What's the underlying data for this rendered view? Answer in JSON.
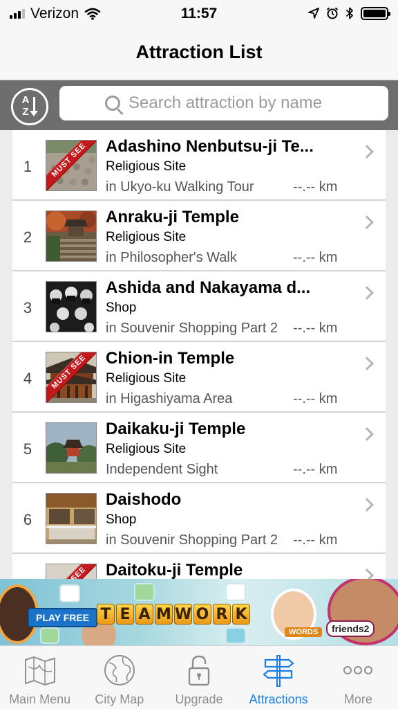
{
  "status_bar": {
    "carrier": "Verizon",
    "time": "11:57"
  },
  "nav": {
    "title": "Attraction List"
  },
  "search": {
    "placeholder": "Search attraction by name",
    "sort_label_a": "A",
    "sort_label_z": "Z"
  },
  "attractions": [
    {
      "number": "1",
      "name": "Adashino Nenbutsu-ji Te...",
      "category": "Religious Site",
      "location": "in Ukyo-ku Walking Tour",
      "distance": "--.-- km",
      "badge": "MUST SEE"
    },
    {
      "number": "2",
      "name": "Anraku-ji Temple",
      "category": "Religious Site",
      "location": "in Philosopher's Walk",
      "distance": "--.-- km",
      "badge": ""
    },
    {
      "number": "3",
      "name": "Ashida and Nakayama d...",
      "category": "Shop",
      "location": "in Souvenir Shopping Part 2",
      "distance": "--.-- km",
      "badge": ""
    },
    {
      "number": "4",
      "name": "Chion-in Temple",
      "category": "Religious Site",
      "location": "in Higashiyama Area",
      "distance": "--.-- km",
      "badge": "MUST SEE"
    },
    {
      "number": "5",
      "name": "Daikaku-ji Temple",
      "category": "Religious Site",
      "location": "Independent Sight",
      "distance": "--.-- km",
      "badge": ""
    },
    {
      "number": "6",
      "name": "Daishodo",
      "category": "Shop",
      "location": "in Souvenir Shopping Part 2",
      "distance": "--.-- km",
      "badge": ""
    },
    {
      "number": "",
      "name": "Daitoku-ji Temple",
      "category": "",
      "location": "",
      "distance": "",
      "badge": "MUST SEE"
    }
  ],
  "ad": {
    "play_free": "PLAY FREE",
    "teamwork_letters": [
      "T",
      "E",
      "A",
      "M",
      "W",
      "O",
      "R",
      "K"
    ],
    "words_tag": "WORDS",
    "friends_tag": "friends2"
  },
  "tabs": [
    {
      "label": "Main Menu",
      "icon": "map-icon",
      "active": false
    },
    {
      "label": "City Map",
      "icon": "globe-icon",
      "active": false
    },
    {
      "label": "Upgrade",
      "icon": "lock-icon",
      "active": false
    },
    {
      "label": "Attractions",
      "icon": "signpost-icon",
      "active": true
    },
    {
      "label": "More",
      "icon": "more-icon",
      "active": false
    }
  ],
  "colors": {
    "active_tab": "#1a7fe6",
    "search_bar_bg": "#6e6e6e",
    "must_see_ribbon": "#c3191d"
  }
}
